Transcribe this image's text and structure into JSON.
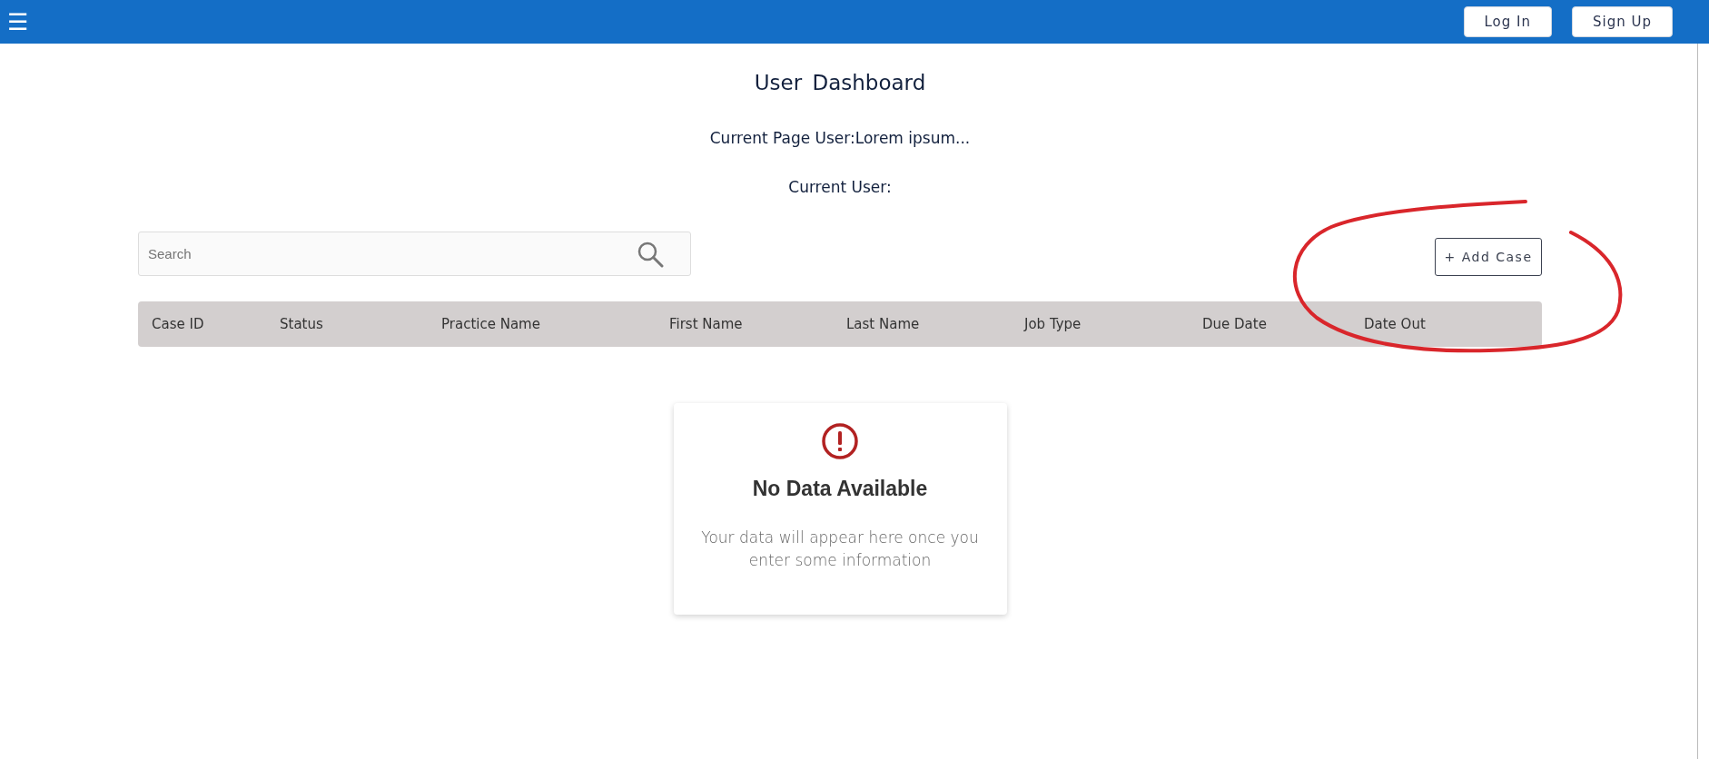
{
  "topbar": {
    "menu_icon": "☰",
    "buttons": [
      {
        "label": "Log In"
      },
      {
        "label": "Sign Up"
      }
    ]
  },
  "title": "User  Dashboard",
  "current_page_user": "Current Page User:Lorem ipsum...",
  "current_user": "Current User:",
  "search": {
    "placeholder": "Search"
  },
  "add_button": {
    "label": "+ Add Case"
  },
  "table": {
    "columns": [
      "Case ID",
      "Status",
      "Practice Name",
      "First Name",
      "Last Name",
      "Job Type",
      "Due Date",
      "Date Out"
    ]
  },
  "empty_state": {
    "title": "No Data Available",
    "message": "Your data will appear here once you enter some information"
  },
  "annotation": {
    "kind": "loop"
  }
}
